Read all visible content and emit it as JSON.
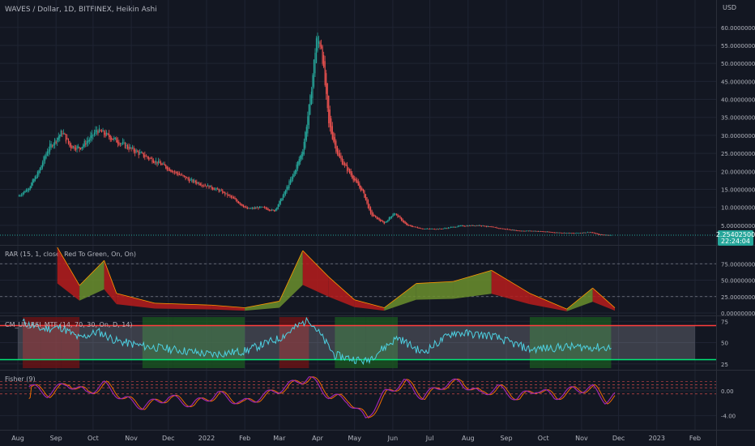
{
  "chart_data": [
    {
      "type": "candlestick",
      "title": "WAVES / Dollar, 1D, BITFINEX, Heikin Ashi",
      "currency_label": "USD",
      "y_ticks": [
        "5.00000000",
        "10.00000000",
        "15.00000000",
        "20.00000000",
        "25.00000000",
        "30.00000000",
        "35.00000000",
        "40.00000000",
        "45.00000000",
        "50.00000000",
        "55.00000000",
        "60.00000000"
      ],
      "ylim": [
        0,
        64
      ],
      "x_ticks": [
        "Aug",
        "Sep",
        "Oct",
        "Nov",
        "Dec",
        "2022",
        "Feb",
        "Mar",
        "Apr",
        "May",
        "Jun",
        "Jul",
        "Aug",
        "Sep",
        "Oct",
        "Nov",
        "Dec",
        "2023",
        "Feb"
      ],
      "series": [
        {
          "values": [
            {
              "x": "2021-08-01",
              "y": 13.0
            },
            {
              "x": "2021-08-10",
              "y": 15.5
            },
            {
              "x": "2021-08-18",
              "y": 20.0
            },
            {
              "x": "2021-08-25",
              "y": 26.0
            },
            {
              "x": "2021-09-01",
              "y": 29.0
            },
            {
              "x": "2021-09-06",
              "y": 31.0
            },
            {
              "x": "2021-09-12",
              "y": 27.0
            },
            {
              "x": "2021-09-20",
              "y": 26.5
            },
            {
              "x": "2021-09-28",
              "y": 29.0
            },
            {
              "x": "2021-10-04",
              "y": 31.5
            },
            {
              "x": "2021-10-12",
              "y": 30.0
            },
            {
              "x": "2021-10-20",
              "y": 28.5
            },
            {
              "x": "2021-10-30",
              "y": 26.5
            },
            {
              "x": "2021-11-10",
              "y": 24.5
            },
            {
              "x": "2021-11-22",
              "y": 22.5
            },
            {
              "x": "2021-12-05",
              "y": 20.0
            },
            {
              "x": "2021-12-18",
              "y": 17.5
            },
            {
              "x": "2022-01-01",
              "y": 16.0
            },
            {
              "x": "2022-01-12",
              "y": 14.5
            },
            {
              "x": "2022-01-22",
              "y": 12.5
            },
            {
              "x": "2022-02-03",
              "y": 9.5
            },
            {
              "x": "2022-02-14",
              "y": 10.0
            },
            {
              "x": "2022-02-25",
              "y": 9.0
            },
            {
              "x": "2022-03-05",
              "y": 14.0
            },
            {
              "x": "2022-03-12",
              "y": 19.0
            },
            {
              "x": "2022-03-20",
              "y": 26.0
            },
            {
              "x": "2022-03-26",
              "y": 40.0
            },
            {
              "x": "2022-03-31",
              "y": 57.0
            },
            {
              "x": "2022-04-04",
              "y": 55.0
            },
            {
              "x": "2022-04-10",
              "y": 33.0
            },
            {
              "x": "2022-04-18",
              "y": 24.0
            },
            {
              "x": "2022-04-28",
              "y": 19.0
            },
            {
              "x": "2022-05-08",
              "y": 14.0
            },
            {
              "x": "2022-05-14",
              "y": 8.0
            },
            {
              "x": "2022-05-25",
              "y": 5.5
            },
            {
              "x": "2022-06-02",
              "y": 8.5
            },
            {
              "x": "2022-06-12",
              "y": 5.0
            },
            {
              "x": "2022-06-25",
              "y": 4.0
            },
            {
              "x": "2022-07-10",
              "y": 4.0
            },
            {
              "x": "2022-07-25",
              "y": 4.8
            },
            {
              "x": "2022-08-10",
              "y": 5.0
            },
            {
              "x": "2022-08-25",
              "y": 4.2
            },
            {
              "x": "2022-09-10",
              "y": 3.5
            },
            {
              "x": "2022-09-25",
              "y": 3.4
            },
            {
              "x": "2022-10-10",
              "y": 3.0
            },
            {
              "x": "2022-10-25",
              "y": 2.8
            },
            {
              "x": "2022-11-08",
              "y": 3.1
            },
            {
              "x": "2022-11-15",
              "y": 2.4
            },
            {
              "x": "2022-11-25",
              "y": 2.25
            }
          ]
        }
      ],
      "last_price": "2.25402500",
      "countdown": "22:24:04"
    },
    {
      "type": "area",
      "title": "RAR (15, 1, close, Red To Green, On, On)",
      "y_ticks": [
        "0.00000000",
        "25.00000000",
        "50.00000000",
        "75.00000000"
      ],
      "ylim": [
        0,
        100
      ],
      "reference_lines": [
        25,
        75
      ],
      "series": [
        {
          "values": [
            {
              "x": "2021-09-02",
              "y": 100
            },
            {
              "x": "2021-09-20",
              "y": 42
            },
            {
              "x": "2021-10-10",
              "y": 80
            },
            {
              "x": "2021-10-20",
              "y": 30
            },
            {
              "x": "2021-11-20",
              "y": 15
            },
            {
              "x": "2022-01-05",
              "y": 12
            },
            {
              "x": "2022-02-01",
              "y": 8
            },
            {
              "x": "2022-03-01",
              "y": 18
            },
            {
              "x": "2022-03-20",
              "y": 95
            },
            {
              "x": "2022-04-10",
              "y": 55
            },
            {
              "x": "2022-05-01",
              "y": 20
            },
            {
              "x": "2022-05-25",
              "y": 8
            },
            {
              "x": "2022-06-20",
              "y": 45
            },
            {
              "x": "2022-07-20",
              "y": 48
            },
            {
              "x": "2022-08-20",
              "y": 65
            },
            {
              "x": "2022-09-20",
              "y": 30
            },
            {
              "x": "2022-10-20",
              "y": 6
            },
            {
              "x": "2022-11-10",
              "y": 38
            },
            {
              "x": "2022-11-28",
              "y": 8
            }
          ]
        }
      ]
    },
    {
      "type": "line",
      "title": "CM_Ult_RSI_MTF (14, 70, 30, On, D, 14)",
      "y_ticks": [
        "25",
        "50",
        "75"
      ],
      "ylim": [
        20,
        80
      ],
      "reference_lines": [
        70,
        30
      ],
      "series": [
        {
          "values": [
            {
              "x": "2021-08-05",
              "y": 74
            },
            {
              "x": "2021-08-20",
              "y": 66
            },
            {
              "x": "2021-09-05",
              "y": 68
            },
            {
              "x": "2021-09-20",
              "y": 55
            },
            {
              "x": "2021-10-05",
              "y": 63
            },
            {
              "x": "2021-10-20",
              "y": 52
            },
            {
              "x": "2021-11-10",
              "y": 46
            },
            {
              "x": "2021-12-05",
              "y": 42
            },
            {
              "x": "2022-01-05",
              "y": 36
            },
            {
              "x": "2022-02-01",
              "y": 40
            },
            {
              "x": "2022-03-01",
              "y": 55
            },
            {
              "x": "2022-03-25",
              "y": 78
            },
            {
              "x": "2022-04-15",
              "y": 35
            },
            {
              "x": "2022-05-10",
              "y": 28
            },
            {
              "x": "2022-06-05",
              "y": 56
            },
            {
              "x": "2022-06-25",
              "y": 38
            },
            {
              "x": "2022-07-20",
              "y": 62
            },
            {
              "x": "2022-08-20",
              "y": 58
            },
            {
              "x": "2022-09-20",
              "y": 42
            },
            {
              "x": "2022-10-20",
              "y": 45
            },
            {
              "x": "2022-11-25",
              "y": 44
            }
          ]
        }
      ]
    },
    {
      "type": "line",
      "title": "Fisher (9)",
      "y_ticks": [
        "0.00",
        "-4.00"
      ],
      "ylim": [
        -6,
        3
      ],
      "series": [
        {
          "values": [
            {
              "x": "2021-08-10",
              "y": 0.8
            },
            {
              "x": "2021-08-25",
              "y": -0.5
            },
            {
              "x": "2021-09-10",
              "y": 1.2
            },
            {
              "x": "2021-09-25",
              "y": -0.3
            },
            {
              "x": "2021-10-10",
              "y": 1.0
            },
            {
              "x": "2021-10-25",
              "y": -1.2
            },
            {
              "x": "2021-11-10",
              "y": -2.5
            },
            {
              "x": "2021-12-01",
              "y": -1.0
            },
            {
              "x": "2021-12-20",
              "y": -2.2
            },
            {
              "x": "2022-01-10",
              "y": -0.5
            },
            {
              "x": "2022-01-30",
              "y": -2.0
            },
            {
              "x": "2022-02-20",
              "y": -0.5
            },
            {
              "x": "2022-03-10",
              "y": 1.0
            },
            {
              "x": "2022-03-25",
              "y": 2.2
            },
            {
              "x": "2022-04-10",
              "y": -0.8
            },
            {
              "x": "2022-04-25",
              "y": -1.5
            },
            {
              "x": "2022-05-10",
              "y": -4.5
            },
            {
              "x": "2022-05-25",
              "y": -0.5
            },
            {
              "x": "2022-06-10",
              "y": 1.5
            },
            {
              "x": "2022-06-25",
              "y": -1.0
            },
            {
              "x": "2022-07-10",
              "y": 0.8
            },
            {
              "x": "2022-07-25",
              "y": 1.5
            },
            {
              "x": "2022-08-10",
              "y": -0.5
            },
            {
              "x": "2022-08-25",
              "y": 0.5
            },
            {
              "x": "2022-09-10",
              "y": -1.2
            },
            {
              "x": "2022-09-25",
              "y": 0.3
            },
            {
              "x": "2022-10-10",
              "y": -1.0
            },
            {
              "x": "2022-10-25",
              "y": 0.2
            },
            {
              "x": "2022-11-10",
              "y": 0.4
            },
            {
              "x": "2022-11-20",
              "y": -1.5
            },
            {
              "x": "2022-11-28",
              "y": -0.8
            }
          ]
        }
      ]
    }
  ],
  "colors": {
    "background": "#131722",
    "grid": "#1f2433",
    "text": "#b2b5be",
    "up": "#26a69a",
    "down": "#ef5350",
    "price_tag": "#26a69a",
    "rar_green": "#6b8f2d",
    "rar_red": "#b71c1c",
    "rsi_line": "#4dd0e1",
    "rsi_green_band": "#1b5e20",
    "rsi_red_band": "#7a1313",
    "fisher_line": "#9c27b0",
    "fisher_trigger": "#ef6c00"
  }
}
